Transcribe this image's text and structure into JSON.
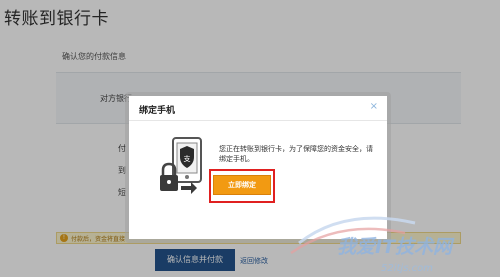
{
  "page": {
    "title": "转账到银行卡"
  },
  "form": {
    "section_label": "确认您的付款信息",
    "payee_label": "对方银行",
    "row_a_label": "付",
    "row_b_label": "到",
    "row_c_label": "短"
  },
  "warning": {
    "text": "付款后，资金将直接"
  },
  "actions": {
    "confirm_label": "确认信息并付款",
    "back_label": "返回修改"
  },
  "modal": {
    "title": "绑定手机",
    "close": "×",
    "message": "您正在转账到银行卡，为了保障您的资金安全，请绑定手机。",
    "bind_button": "立即绑定"
  },
  "watermark": {
    "text": "我爱IT技术网",
    "url": "52itjs.com"
  },
  "colors": {
    "primary_button": "#24548d",
    "bind_button": "#f29a12",
    "highlight": "#e02020",
    "link": "#2a5fa0"
  }
}
